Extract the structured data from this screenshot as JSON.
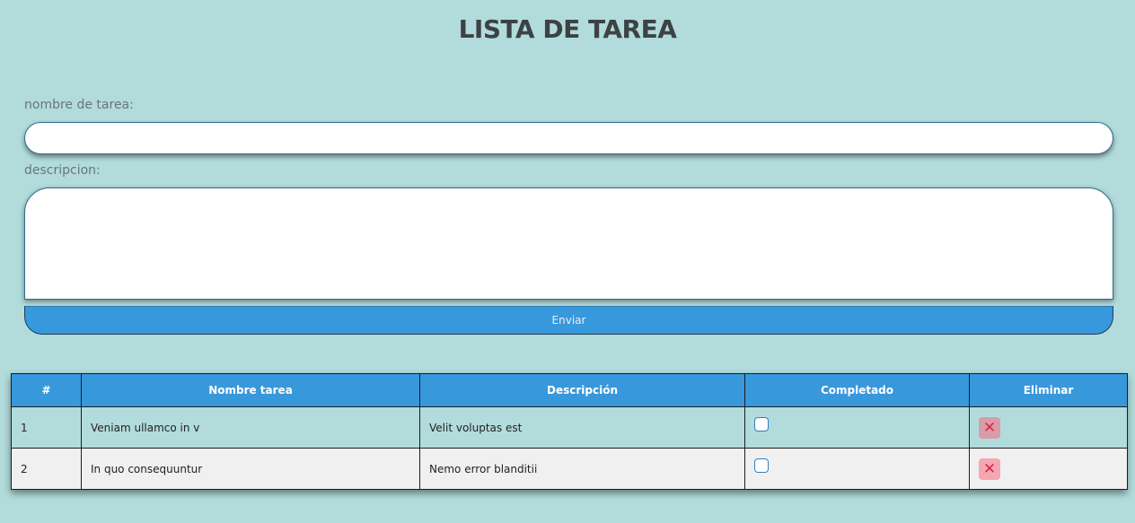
{
  "page": {
    "title": "LISTA DE TAREA"
  },
  "form": {
    "name_label": "nombre de tarea:",
    "name_value": "",
    "description_label": "descripcion:",
    "description_value": "",
    "submit_label": "Enviar"
  },
  "table": {
    "columns": [
      "#",
      "Nombre tarea",
      "Descripción",
      "Completado",
      "Eliminar"
    ],
    "rows": [
      {
        "id": "1",
        "name": "Veniam ullamco in v",
        "description": "Velit voluptas est",
        "completed": false,
        "delete_icon": "close-icon"
      },
      {
        "id": "2",
        "name": "In quo consequuntur",
        "description": "Nemo error blanditii",
        "completed": false,
        "delete_icon": "close-icon"
      }
    ]
  },
  "colors": {
    "background": "#b2dcdc",
    "accent": "#3898dc",
    "delete": "#e0264a"
  }
}
